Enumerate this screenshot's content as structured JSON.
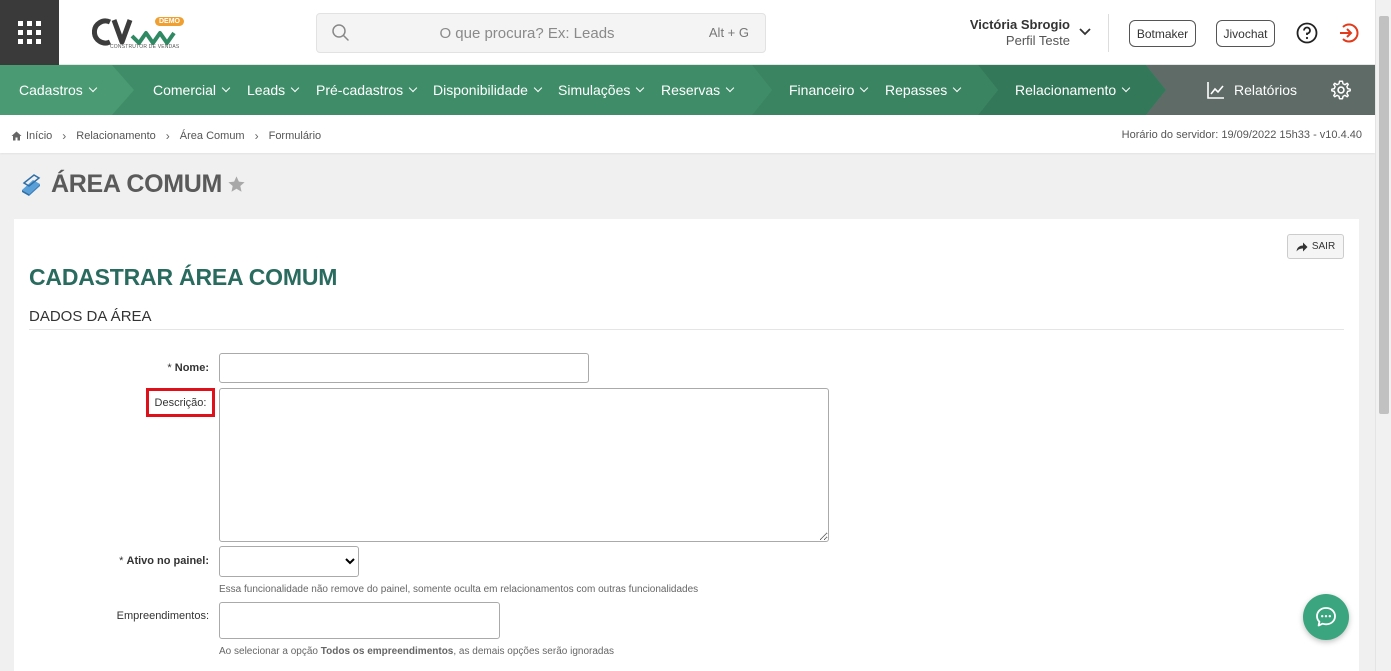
{
  "header": {
    "logo_text": "CV",
    "logo_badge": "DEMO",
    "logo_subtitle": "CONSTRUTOR DE VENDAS",
    "search": {
      "placeholder": "O que procura? Ex: Leads",
      "shortcut": "Alt + G"
    },
    "user": {
      "name": "Victória Sbrogio",
      "profile": "Perfil Teste"
    },
    "buttons": {
      "botmaker": "Botmaker",
      "jivochat": "Jivochat"
    },
    "icons": [
      "apps-grid-icon",
      "search-icon",
      "chevron-down-icon",
      "help-icon",
      "logout-icon"
    ]
  },
  "nav": {
    "colors": {
      "light": "#4a9a74",
      "mid": "#3f8d68",
      "dark": "#34785a",
      "gray": "#5e6b66"
    },
    "items": [
      {
        "label": "Cadastros"
      },
      {
        "label": "Comercial"
      },
      {
        "label": "Leads"
      },
      {
        "label": "Pré-cadastros"
      },
      {
        "label": "Disponibilidade"
      },
      {
        "label": "Simulações"
      },
      {
        "label": "Reservas"
      },
      {
        "label": "Financeiro"
      },
      {
        "label": "Repasses"
      },
      {
        "label": "Relacionamento"
      }
    ],
    "reports_label": "Relatórios"
  },
  "breadcrumb": {
    "items": [
      "Início",
      "Relacionamento",
      "Área Comum",
      "Formulário"
    ],
    "server_time": "Horário do servidor: 19/09/2022 15h33 - v10.4.40"
  },
  "page": {
    "title": "ÁREA COMUM"
  },
  "form": {
    "exit_label": "SAIR",
    "title": "CADASTRAR ÁREA COMUM",
    "section": "DADOS DA ÁREA",
    "fields": {
      "nome": {
        "required_mark": "*",
        "label": "Nome:",
        "value": ""
      },
      "descricao": {
        "label": "Descrição:",
        "value": ""
      },
      "ativo": {
        "required_mark": "*",
        "label": "Ativo no painel:",
        "value": "",
        "hint": "Essa funcionalidade não remove do painel, somente oculta em relacionamentos com outras funcionalidades"
      },
      "empreendimentos": {
        "label": "Empreendimentos:",
        "value": "",
        "hint_prefix": "Ao selecionar a opção",
        "hint_bold": "Todos os empreendimentos",
        "hint_suffix": ", as demais opções serão ignoradas"
      }
    },
    "highlight_color": "#e0101a",
    "title_color": "#2a6b5f"
  },
  "chat": {
    "icon": "chat-bubble-icon",
    "color": "#3aa57e"
  }
}
